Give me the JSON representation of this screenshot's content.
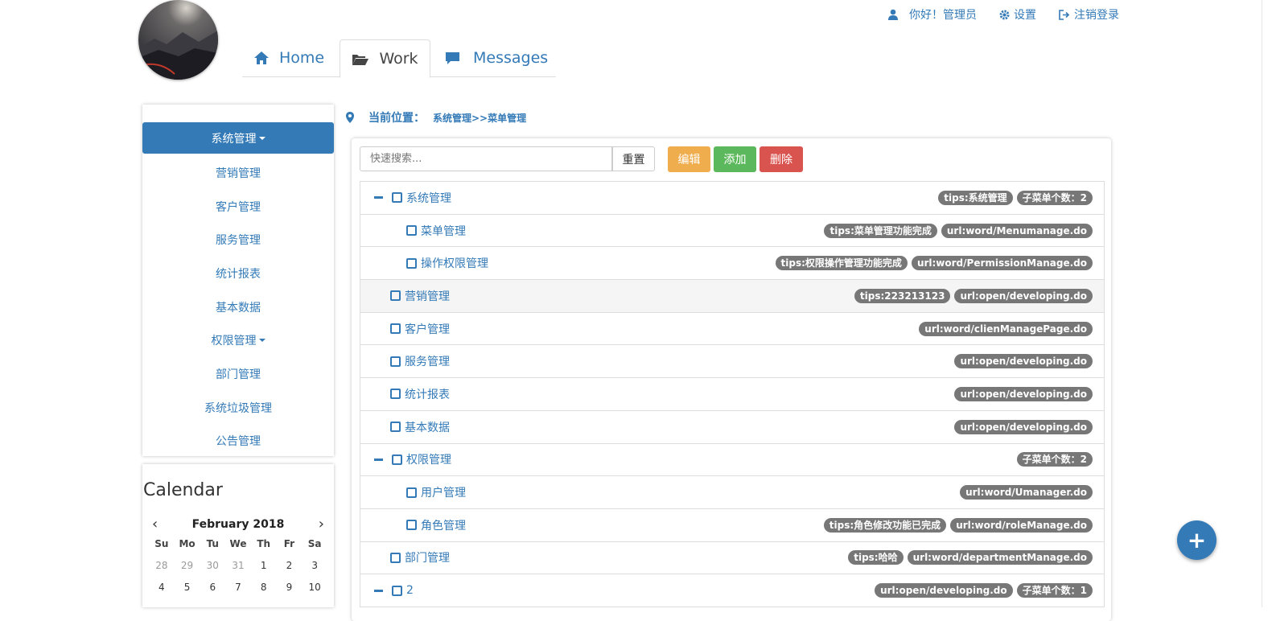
{
  "header": {
    "user_greeting": "你好！管理员",
    "settings_label": "设置",
    "logout_label": "注销登录"
  },
  "tabs": [
    {
      "label": "Home",
      "icon": "home-icon"
    },
    {
      "label": "Work",
      "icon": "folder-open-icon",
      "active": true
    },
    {
      "label": "Messages",
      "icon": "comment-icon"
    }
  ],
  "sidebar": {
    "items": [
      {
        "label": "系统管理",
        "active": true,
        "dropdown": true
      },
      {
        "label": "营销管理"
      },
      {
        "label": "客户管理"
      },
      {
        "label": "服务管理"
      },
      {
        "label": "统计报表"
      },
      {
        "label": "基本数据"
      },
      {
        "label": "权限管理",
        "dropdown": true
      },
      {
        "label": "部门管理"
      },
      {
        "label": "系统垃圾管理"
      },
      {
        "label": "公告管理"
      }
    ]
  },
  "calendar": {
    "title": "Calendar",
    "month": "February 2018",
    "prev": "‹",
    "next": "›",
    "weekdays": [
      "Su",
      "Mo",
      "Tu",
      "We",
      "Th",
      "Fr",
      "Sa"
    ],
    "days": [
      {
        "d": "28",
        "muted": true
      },
      {
        "d": "29",
        "muted": true
      },
      {
        "d": "30",
        "muted": true
      },
      {
        "d": "31",
        "muted": true
      },
      {
        "d": "1"
      },
      {
        "d": "2"
      },
      {
        "d": "3"
      },
      {
        "d": "4"
      },
      {
        "d": "5"
      },
      {
        "d": "6"
      },
      {
        "d": "7"
      },
      {
        "d": "8"
      },
      {
        "d": "9"
      },
      {
        "d": "10"
      }
    ]
  },
  "breadcrumb": {
    "label": "当前位置：",
    "path": "系统管理>>菜单管理"
  },
  "toolbar": {
    "search_placeholder": "快速搜索...",
    "reset_label": "重置",
    "edit_label": "编辑",
    "add_label": "添加",
    "delete_label": "删除"
  },
  "colors": {
    "primary": "#337ab7",
    "warning": "#f0ad4e",
    "success": "#5cb85c",
    "danger": "#d9534f",
    "badge": "#777777"
  },
  "tree": [
    {
      "label": "系统管理",
      "level": 0,
      "expanded": true,
      "badges": [
        "tips:系统管理",
        "子菜单个数：2"
      ]
    },
    {
      "label": "菜单管理",
      "level": 1,
      "badges": [
        "tips:菜单管理功能完成",
        "url:word/Menumanage.do"
      ]
    },
    {
      "label": "操作权限管理",
      "level": 1,
      "badges": [
        "tips:权限操作管理功能完成",
        "url:word/PermissionManage.do"
      ]
    },
    {
      "label": "营销管理",
      "level": 0,
      "highlight": true,
      "badges": [
        "tips:223213123",
        "url:open/developing.do"
      ]
    },
    {
      "label": "客户管理",
      "level": 0,
      "badges": [
        "url:word/clienManagePage.do"
      ]
    },
    {
      "label": "服务管理",
      "level": 0,
      "badges": [
        "url:open/developing.do"
      ]
    },
    {
      "label": "统计报表",
      "level": 0,
      "badges": [
        "url:open/developing.do"
      ]
    },
    {
      "label": "基本数据",
      "level": 0,
      "badges": [
        "url:open/developing.do"
      ]
    },
    {
      "label": "权限管理",
      "level": 0,
      "expanded": true,
      "badges": [
        "子菜单个数：2"
      ]
    },
    {
      "label": "用户管理",
      "level": 1,
      "badges": [
        "url:word/Umanager.do"
      ]
    },
    {
      "label": "角色管理",
      "level": 1,
      "badges": [
        "tips:角色修改功能已完成",
        "url:word/roleManage.do"
      ]
    },
    {
      "label": "部门管理",
      "level": 0,
      "badges": [
        "tips:哈哈",
        "url:word/departmentManage.do"
      ]
    },
    {
      "label": "2",
      "level": 0,
      "expanded": true,
      "badges": [
        "url:open/developing.do",
        "子菜单个数：1"
      ]
    }
  ],
  "fab_label": "+"
}
